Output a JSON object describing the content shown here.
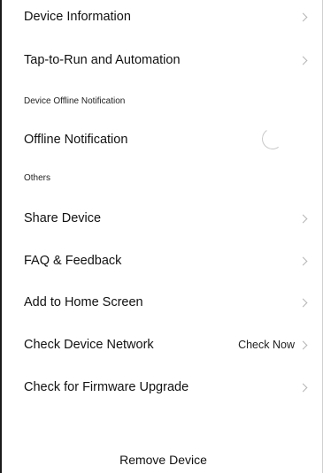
{
  "settings": {
    "rows": [
      {
        "label": "Device Information"
      },
      {
        "label": "Tap-to-Run and Automation"
      }
    ],
    "sections": [
      {
        "header": "Device Offline Notification"
      },
      {
        "header": "Others"
      }
    ],
    "offline_notification": {
      "label": "Offline Notification"
    },
    "others": [
      {
        "label": "Share Device"
      },
      {
        "label": "FAQ & Feedback"
      },
      {
        "label": "Add to Home Screen"
      },
      {
        "label": "Check Device Network",
        "value": "Check Now"
      },
      {
        "label": "Check for Firmware Upgrade"
      }
    ],
    "remove_label": "Remove Device"
  },
  "icons": {
    "chevron": "chevron-right-icon",
    "toggle": "toggle-switch"
  },
  "colors": {
    "text": "#111111",
    "chevron": "#b5b5b5",
    "background": "#ffffff"
  }
}
